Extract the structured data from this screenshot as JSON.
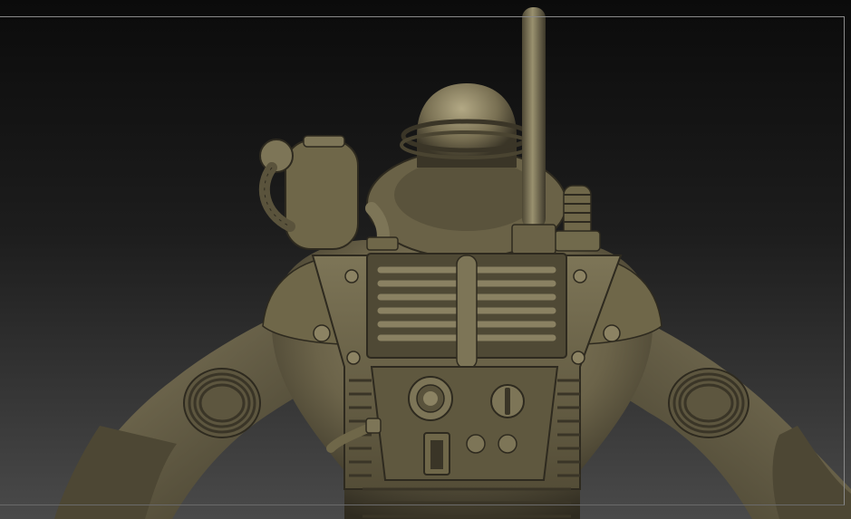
{
  "viewport": {
    "background_top": "#0b0b0b",
    "background_bottom": "#4a4a4a",
    "frame_color": "#8a8a8a"
  },
  "model": {
    "material_base": "#6e6650",
    "material_light": "#9a916f",
    "material_shadow": "#2e2a1f"
  }
}
